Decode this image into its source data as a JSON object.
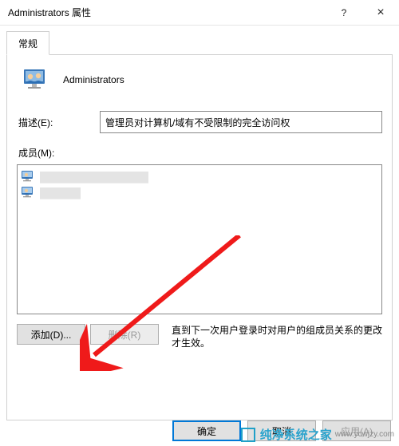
{
  "window": {
    "title": "Administrators 属性",
    "help_icon": "?",
    "close_icon": "×"
  },
  "tabs": {
    "general": "常规"
  },
  "group": {
    "name": "Administrators"
  },
  "desc": {
    "label": "描述(E):",
    "value": "管理员对计算机/域有不受限制的完全访问权"
  },
  "members": {
    "label": "成员(M):",
    "items": [
      {
        "text": "████████████████"
      },
      {
        "text": "██████"
      }
    ]
  },
  "buttons": {
    "add": "添加(D)...",
    "remove": "删除(R)"
  },
  "note": "直到下一次用户登录时对用户的组成员关系的更改才生效。",
  "dialog": {
    "ok": "确定",
    "cancel": "取消",
    "apply": "应用(A)"
  },
  "watermark": {
    "brand": "纯净系统之家",
    "url": "www.ycwjzy.com"
  }
}
